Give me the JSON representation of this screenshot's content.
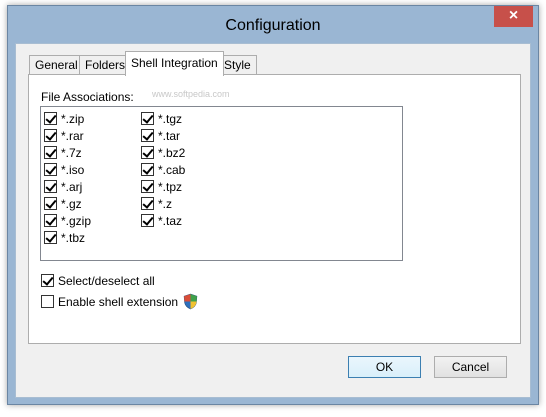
{
  "window": {
    "title": "Configuration",
    "close_glyph": "×"
  },
  "tabs": [
    {
      "label": "General",
      "active": false
    },
    {
      "label": "Folders",
      "active": false
    },
    {
      "label": "Shell Integration",
      "active": true
    },
    {
      "label": "Style",
      "active": false
    }
  ],
  "group_label": "File Associations:",
  "watermark": "www.softpedia.com",
  "associations_col1": [
    {
      "label": "*.zip",
      "checked": true
    },
    {
      "label": "*.rar",
      "checked": true
    },
    {
      "label": "*.7z",
      "checked": true
    },
    {
      "label": "*.iso",
      "checked": true
    },
    {
      "label": "*.arj",
      "checked": true
    },
    {
      "label": "*.gz",
      "checked": true
    },
    {
      "label": "*.gzip",
      "checked": true
    },
    {
      "label": "*.tbz",
      "checked": true
    }
  ],
  "associations_col2": [
    {
      "label": "*.tgz",
      "checked": true
    },
    {
      "label": "*.tar",
      "checked": true
    },
    {
      "label": "*.bz2",
      "checked": true
    },
    {
      "label": "*.cab",
      "checked": true
    },
    {
      "label": "*.tpz",
      "checked": true
    },
    {
      "label": "*.z",
      "checked": true
    },
    {
      "label": "*.taz",
      "checked": true
    }
  ],
  "options": {
    "select_all": {
      "label": "Select/deselect all",
      "checked": true
    },
    "shell_extension": {
      "label": "Enable shell extension",
      "checked": false,
      "icon": "uac-shield-icon"
    }
  },
  "buttons": {
    "ok": "OK",
    "cancel": "Cancel"
  }
}
